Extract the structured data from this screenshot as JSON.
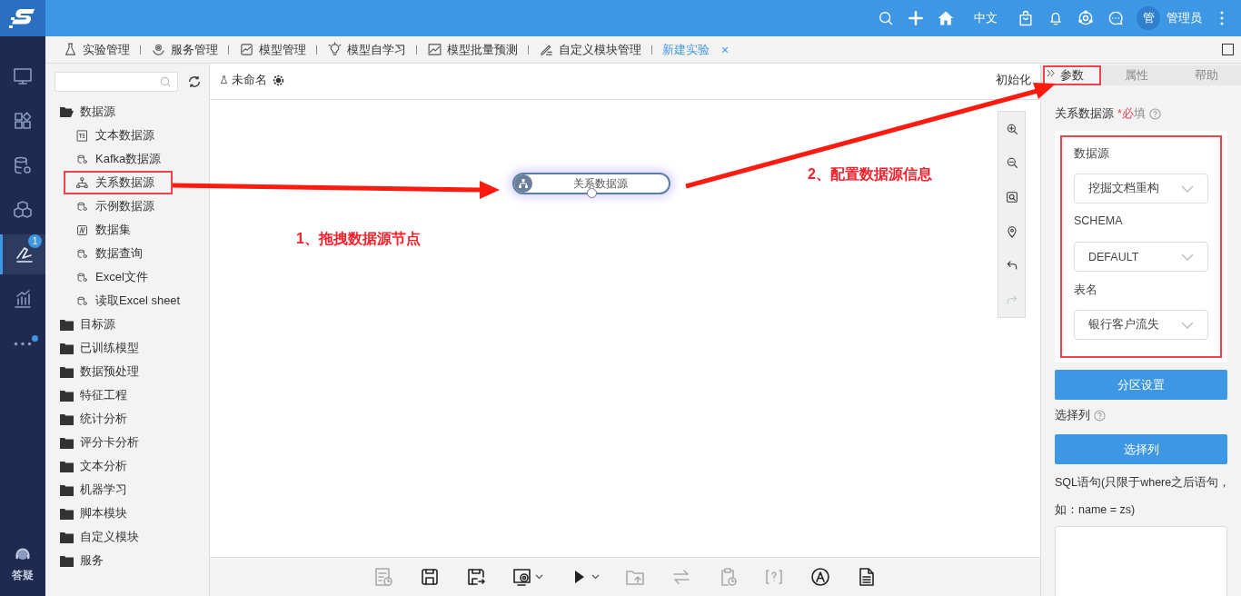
{
  "topbar": {
    "icons": [
      {
        "kind": "search"
      },
      {
        "kind": "plus"
      },
      {
        "kind": "home"
      }
    ],
    "language": "中文",
    "icons_right": [
      {
        "kind": "bag"
      },
      {
        "kind": "bell"
      },
      {
        "kind": "hub"
      },
      {
        "kind": "chat"
      }
    ],
    "avatar": "管",
    "user": "管理员"
  },
  "nav": [
    {
      "kind": "monitor",
      "selected": false
    },
    {
      "kind": "apps",
      "selected": false
    },
    {
      "kind": "database",
      "selected": false
    },
    {
      "kind": "cubes",
      "selected": false
    },
    {
      "kind": "experiment",
      "selected": true,
      "badge": "1"
    },
    {
      "kind": "chart",
      "selected": false
    },
    {
      "kind": "more",
      "selected": false,
      "dot": true
    }
  ],
  "nav_help": "答疑",
  "tabs": [
    {
      "label": "实验管理",
      "kind": "flask",
      "selected": false
    },
    {
      "label": "服务管理",
      "kind": "service",
      "selected": false
    },
    {
      "label": "模型管理",
      "kind": "model",
      "selected": false
    },
    {
      "label": "模型自学习",
      "kind": "bulb",
      "selected": false
    },
    {
      "label": "模型批量预测",
      "kind": "predict",
      "selected": false
    },
    {
      "label": "自定义模块管理",
      "kind": "custom",
      "selected": false
    },
    {
      "label": "新建实验",
      "kind": "none",
      "selected": true,
      "close": "×"
    }
  ],
  "tree": [
    {
      "label": "数据源",
      "expanded": true,
      "children": [
        {
          "label": "文本数据源",
          "kind": "text",
          "highlighted": false
        },
        {
          "label": "Kafka数据源",
          "kind": "db",
          "highlighted": false
        },
        {
          "label": "关系数据源",
          "kind": "relation",
          "highlighted": true
        },
        {
          "label": "示例数据源",
          "kind": "db",
          "highlighted": false
        },
        {
          "label": "数据集",
          "kind": "dataset",
          "highlighted": false
        },
        {
          "label": "数据查询",
          "kind": "db",
          "highlighted": false
        },
        {
          "label": "Excel文件",
          "kind": "db",
          "highlighted": false
        },
        {
          "label": "读取Excel sheet",
          "kind": "db",
          "highlighted": false
        }
      ]
    },
    {
      "label": "目标源",
      "expanded": false
    },
    {
      "label": "已训练模型",
      "expanded": false
    },
    {
      "label": "数据预处理",
      "expanded": false
    },
    {
      "label": "特征工程",
      "expanded": false
    },
    {
      "label": "统计分析",
      "expanded": false
    },
    {
      "label": "评分卡分析",
      "expanded": false
    },
    {
      "label": "文本分析",
      "expanded": false
    },
    {
      "label": "机器学习",
      "expanded": false
    },
    {
      "label": "脚本模块",
      "expanded": false
    },
    {
      "label": "自定义模块",
      "expanded": false
    },
    {
      "label": "服务",
      "expanded": false
    }
  ],
  "canvas": {
    "title": "未命名",
    "action": "初始化",
    "node": {
      "label": "关系数据源"
    },
    "annotations": [
      {
        "text": "1、拖拽数据源节点"
      },
      {
        "text": "2、配置数据源信息"
      }
    ],
    "zoom_tools": [
      {
        "kind": "zoom-in",
        "disabled": false
      },
      {
        "kind": "zoom-out",
        "disabled": false
      },
      {
        "kind": "fit",
        "disabled": false
      },
      {
        "kind": "locate",
        "disabled": false
      },
      {
        "kind": "undo",
        "disabled": false
      },
      {
        "kind": "redo",
        "disabled": true
      }
    ]
  },
  "toolbar": [
    {
      "kind": "report",
      "disabled": true,
      "dropdown": false
    },
    {
      "kind": "save",
      "disabled": false,
      "dropdown": false
    },
    {
      "kind": "save-as",
      "disabled": false,
      "dropdown": false
    },
    {
      "kind": "settings",
      "disabled": false,
      "dropdown": true
    },
    {
      "kind": "run",
      "disabled": false,
      "dropdown": true
    },
    {
      "kind": "upload",
      "disabled": true,
      "dropdown": false
    },
    {
      "kind": "swap",
      "disabled": true,
      "dropdown": false
    },
    {
      "kind": "schedule",
      "disabled": true,
      "dropdown": false
    },
    {
      "kind": "bracket-help",
      "disabled": true,
      "dropdown": false
    },
    {
      "kind": "circle-a",
      "disabled": false,
      "dropdown": false
    },
    {
      "kind": "document",
      "disabled": false,
      "dropdown": false
    }
  ],
  "panel": {
    "tabs": [
      {
        "label": "参数",
        "selected": true,
        "highlighted": true
      },
      {
        "label": "属性",
        "selected": false,
        "highlighted": false
      },
      {
        "label": "帮助",
        "selected": false,
        "highlighted": false
      }
    ],
    "section_label": "关系数据源",
    "required": "*必填",
    "fields_highlighted": true,
    "fields": [
      {
        "label": "数据源",
        "value": "挖掘文档重构"
      },
      {
        "label": "SCHEMA",
        "value": "DEFAULT"
      },
      {
        "label": "表名",
        "value": "银行客户流失"
      }
    ],
    "partition_button": "分区设置",
    "columns_label": "选择列",
    "columns_button": "选择列",
    "sql_label": "SQL语句(只限于where之后语句，",
    "sql_hint": "如：name = zs)"
  }
}
